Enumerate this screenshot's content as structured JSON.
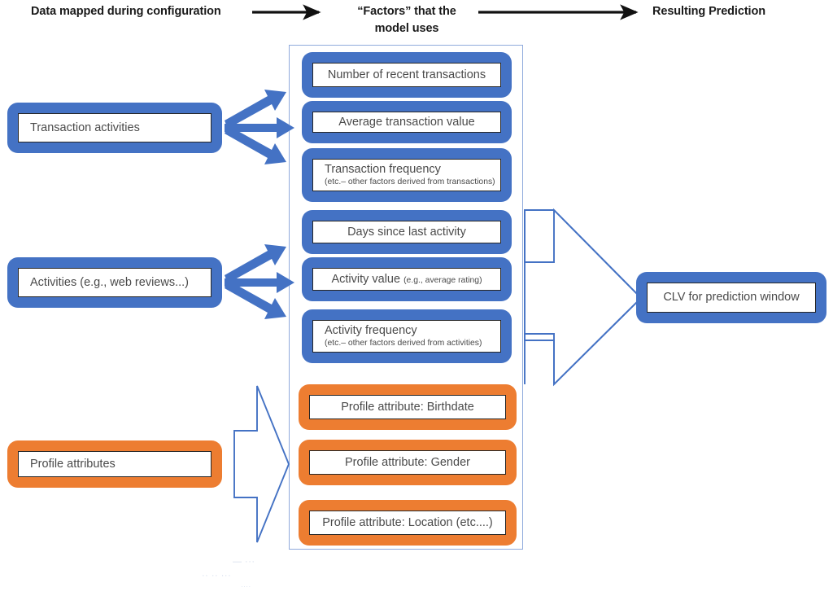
{
  "header": {
    "left_label": "Data mapped during configuration",
    "middle_label": "“Factors” that the\nmodel uses",
    "middle_label_line1": "“Factors” that the",
    "middle_label_line2": "model uses",
    "right_label": "Resulting Prediction",
    "arrow1_name": "header-arrow-left",
    "arrow2_name": "header-arrow-right"
  },
  "colors": {
    "blue": "#4472C4",
    "orange": "#ED7D31",
    "container_border": "#8FAADC",
    "plate_border": "#262626",
    "text": "#4a4a4a",
    "header_text": "#1a1a1a"
  },
  "inputs": [
    {
      "label": "Transaction activities",
      "color": "blue"
    },
    {
      "label": "Activities (e.g., web reviews...)",
      "color": "blue"
    },
    {
      "label": "Profile attributes",
      "color": "orange"
    }
  ],
  "factors": [
    {
      "label": "Number of recent transactions",
      "sub": "",
      "color": "blue",
      "align": "center"
    },
    {
      "label": "Average transaction value",
      "sub": "",
      "color": "blue",
      "align": "center"
    },
    {
      "label": "Transaction frequency",
      "sub": "(etc.– other factors derived from transactions)",
      "color": "blue",
      "align": "left"
    },
    {
      "label": "Days since last activity",
      "sub": "",
      "color": "blue",
      "align": "center"
    },
    {
      "label": "Activity value",
      "inline_sub": "(e.g., average rating)",
      "sub": "",
      "color": "blue",
      "align": "center"
    },
    {
      "label": "Activity frequency",
      "sub": "(etc.– other factors derived from activities)",
      "color": "blue",
      "align": "left"
    },
    {
      "label": "Profile attribute: Birthdate",
      "sub": "",
      "color": "orange",
      "align": "center"
    },
    {
      "label": "Profile attribute: Gender",
      "sub": "",
      "color": "orange",
      "align": "center"
    },
    {
      "label": "Profile attribute: Location (etc....)",
      "sub": "",
      "color": "orange",
      "align": "center"
    }
  ],
  "output": {
    "label": "CLV for prediction window",
    "color": "blue"
  },
  "connectors": {
    "transaction_fan_name": "transaction-arrow-fan",
    "activity_fan_name": "activity-arrow-fan",
    "profile_block_arrow_name": "profile-block-arrow",
    "prediction_block_arrow_name": "prediction-block-arrow"
  },
  "artifact": {
    "line1": "— ···",
    "line2": "·· ·· ···",
    "line3": "····"
  }
}
